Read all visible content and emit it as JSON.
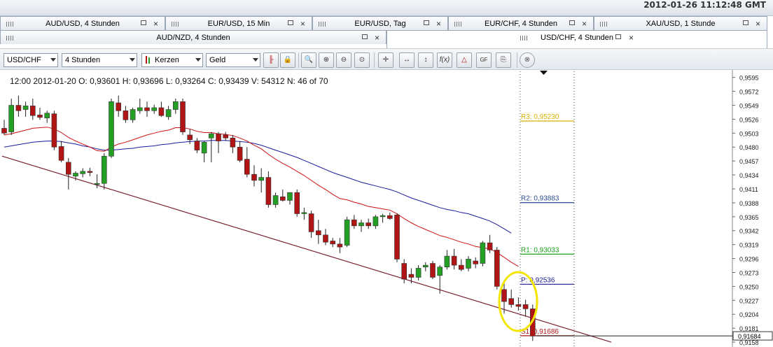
{
  "header": {
    "datetime": "2012-01-26 11:12:48 GMT"
  },
  "tabs_row1": [
    {
      "label": "AUD/USD,  4 Stunden"
    },
    {
      "label": "EUR/USD,  15 Min"
    },
    {
      "label": "EUR/USD,  Tag"
    },
    {
      "label": "EUR/CHF,  4 Stunden"
    },
    {
      "label": "XAU/USD,  1 Stunde"
    }
  ],
  "tabs_row2": [
    {
      "label": "AUD/NZD,  4 Stunden"
    },
    {
      "label": "USD/CHF,  4 Stunden",
      "active": true
    }
  ],
  "toolbar": {
    "instrument": "USD/CHF",
    "period": "4 Stunden",
    "chart_type": "Kerzen",
    "price_side": "Geld",
    "buttons": [
      "candle-settings-icon",
      "lock-icon",
      "zoom-icon",
      "zoom-in-icon",
      "zoom-out-icon",
      "zoom-fit-icon",
      "crosshair-icon",
      "horizontal-line-icon",
      "vertical-line-icon",
      "indicator-fx-icon",
      "pattern-icon",
      "fibonacci-icon",
      "copy-icon",
      "save-icon",
      "close-chart-icon"
    ]
  },
  "chart_data": {
    "type": "candlestick",
    "info": "12:00  2012-01-20   O: 0,93601   H: 0,93696   L: 0,93264   C: 0,93439   V: 54312   N: 46 of 70",
    "ylim": [
      0.915,
      0.9605
    ],
    "y_ticks": [
      "0,9595",
      "0,9572",
      "0,9549",
      "0,9526",
      "0,9503",
      "0,9480",
      "0,9457",
      "0,9434",
      "0,9411",
      "0,9388",
      "0,9365",
      "0,9342",
      "0,9319",
      "0,9296",
      "0,9273",
      "0,9250",
      "0,9227",
      "0,9204",
      "0,9181",
      "0,9158"
    ],
    "current_price": "0,91684",
    "colors": {
      "up": "#23a023",
      "down": "#b01414",
      "ma_fast": "#cc1111",
      "ma_slow": "#1a1a9c",
      "trend": "#7a2030",
      "highlight": "#f2e600"
    },
    "candles": [
      {
        "o": 0.9511,
        "h": 0.9525,
        "l": 0.95,
        "c": 0.9503
      },
      {
        "o": 0.9505,
        "h": 0.956,
        "l": 0.95,
        "c": 0.9549
      },
      {
        "o": 0.9549,
        "h": 0.9565,
        "l": 0.953,
        "c": 0.954
      },
      {
        "o": 0.9542,
        "h": 0.9555,
        "l": 0.953,
        "c": 0.9548
      },
      {
        "o": 0.9548,
        "h": 0.956,
        "l": 0.9525,
        "c": 0.9532
      },
      {
        "o": 0.9533,
        "h": 0.9545,
        "l": 0.9525,
        "c": 0.9529
      },
      {
        "o": 0.9528,
        "h": 0.954,
        "l": 0.952,
        "c": 0.9536
      },
      {
        "o": 0.9535,
        "h": 0.954,
        "l": 0.9475,
        "c": 0.948
      },
      {
        "o": 0.9481,
        "h": 0.949,
        "l": 0.9455,
        "c": 0.9458
      },
      {
        "o": 0.9455,
        "h": 0.9462,
        "l": 0.941,
        "c": 0.9435
      },
      {
        "o": 0.9432,
        "h": 0.944,
        "l": 0.9425,
        "c": 0.9437
      },
      {
        "o": 0.9436,
        "h": 0.9445,
        "l": 0.943,
        "c": 0.944
      },
      {
        "o": 0.944,
        "h": 0.9446,
        "l": 0.9432,
        "c": 0.9438
      },
      {
        "o": 0.942,
        "h": 0.9435,
        "l": 0.9412,
        "c": 0.942
      },
      {
        "o": 0.942,
        "h": 0.947,
        "l": 0.941,
        "c": 0.9465
      },
      {
        "o": 0.9465,
        "h": 0.956,
        "l": 0.9462,
        "c": 0.9555
      },
      {
        "o": 0.9553,
        "h": 0.9565,
        "l": 0.953,
        "c": 0.954
      },
      {
        "o": 0.954,
        "h": 0.9548,
        "l": 0.952,
        "c": 0.9525
      },
      {
        "o": 0.9525,
        "h": 0.9545,
        "l": 0.952,
        "c": 0.9542
      },
      {
        "o": 0.954,
        "h": 0.956,
        "l": 0.9535,
        "c": 0.9545
      },
      {
        "o": 0.9545,
        "h": 0.9555,
        "l": 0.953,
        "c": 0.954
      },
      {
        "o": 0.954,
        "h": 0.955,
        "l": 0.9535,
        "c": 0.9545
      },
      {
        "o": 0.9545,
        "h": 0.9555,
        "l": 0.953,
        "c": 0.9532
      },
      {
        "o": 0.953,
        "h": 0.9548,
        "l": 0.9525,
        "c": 0.9542
      },
      {
        "o": 0.9542,
        "h": 0.956,
        "l": 0.9535,
        "c": 0.9555
      },
      {
        "o": 0.9555,
        "h": 0.956,
        "l": 0.95,
        "c": 0.9505
      },
      {
        "o": 0.95,
        "h": 0.951,
        "l": 0.9485,
        "c": 0.9492
      },
      {
        "o": 0.949,
        "h": 0.9495,
        "l": 0.947,
        "c": 0.9475
      },
      {
        "o": 0.947,
        "h": 0.949,
        "l": 0.9455,
        "c": 0.9488
      },
      {
        "o": 0.9495,
        "h": 0.9505,
        "l": 0.9455,
        "c": 0.9502
      },
      {
        "o": 0.9502,
        "h": 0.9505,
        "l": 0.947,
        "c": 0.949
      },
      {
        "o": 0.95,
        "h": 0.9505,
        "l": 0.949,
        "c": 0.9495
      },
      {
        "o": 0.9495,
        "h": 0.95,
        "l": 0.947,
        "c": 0.948
      },
      {
        "o": 0.948,
        "h": 0.949,
        "l": 0.9455,
        "c": 0.9458
      },
      {
        "o": 0.946,
        "h": 0.948,
        "l": 0.943,
        "c": 0.9435
      },
      {
        "o": 0.9435,
        "h": 0.945,
        "l": 0.9415,
        "c": 0.9425
      },
      {
        "o": 0.9425,
        "h": 0.9445,
        "l": 0.9405,
        "c": 0.943
      },
      {
        "o": 0.943,
        "h": 0.944,
        "l": 0.938,
        "c": 0.9385
      },
      {
        "o": 0.9385,
        "h": 0.9405,
        "l": 0.938,
        "c": 0.94
      },
      {
        "o": 0.9398,
        "h": 0.941,
        "l": 0.939,
        "c": 0.9392
      },
      {
        "o": 0.9392,
        "h": 0.9405,
        "l": 0.9385,
        "c": 0.9405
      },
      {
        "o": 0.9405,
        "h": 0.941,
        "l": 0.9365,
        "c": 0.937
      },
      {
        "o": 0.937,
        "h": 0.938,
        "l": 0.936,
        "c": 0.9372
      },
      {
        "o": 0.937,
        "h": 0.9375,
        "l": 0.933,
        "c": 0.934
      },
      {
        "o": 0.9342,
        "h": 0.936,
        "l": 0.932,
        "c": 0.9335
      },
      {
        "o": 0.9335,
        "h": 0.9345,
        "l": 0.9318,
        "c": 0.9323
      },
      {
        "o": 0.9325,
        "h": 0.933,
        "l": 0.9315,
        "c": 0.932
      },
      {
        "o": 0.932,
        "h": 0.933,
        "l": 0.9305,
        "c": 0.9315
      },
      {
        "o": 0.9318,
        "h": 0.9365,
        "l": 0.9315,
        "c": 0.936
      },
      {
        "o": 0.936,
        "h": 0.9368,
        "l": 0.9345,
        "c": 0.935
      },
      {
        "o": 0.935,
        "h": 0.936,
        "l": 0.934,
        "c": 0.9355
      },
      {
        "o": 0.9355,
        "h": 0.9362,
        "l": 0.9345,
        "c": 0.935
      },
      {
        "o": 0.935,
        "h": 0.9368,
        "l": 0.9345,
        "c": 0.9365
      },
      {
        "o": 0.9365,
        "h": 0.937,
        "l": 0.9355,
        "c": 0.9367
      },
      {
        "o": 0.9367,
        "h": 0.9372,
        "l": 0.936,
        "c": 0.9362
      },
      {
        "o": 0.9368,
        "h": 0.937,
        "l": 0.929,
        "c": 0.9295
      },
      {
        "o": 0.9288,
        "h": 0.9295,
        "l": 0.9255,
        "c": 0.9262
      },
      {
        "o": 0.927,
        "h": 0.928,
        "l": 0.9255,
        "c": 0.9265
      },
      {
        "o": 0.9265,
        "h": 0.9285,
        "l": 0.926,
        "c": 0.928
      },
      {
        "o": 0.9282,
        "h": 0.929,
        "l": 0.9275,
        "c": 0.9285
      },
      {
        "o": 0.9288,
        "h": 0.9292,
        "l": 0.9262,
        "c": 0.9265
      },
      {
        "o": 0.9268,
        "h": 0.9285,
        "l": 0.9238,
        "c": 0.9282
      },
      {
        "o": 0.9282,
        "h": 0.931,
        "l": 0.9278,
        "c": 0.93
      },
      {
        "o": 0.93,
        "h": 0.9312,
        "l": 0.9278,
        "c": 0.9285
      },
      {
        "o": 0.9285,
        "h": 0.9295,
        "l": 0.9275,
        "c": 0.9278
      },
      {
        "o": 0.928,
        "h": 0.93,
        "l": 0.9275,
        "c": 0.9295
      },
      {
        "o": 0.9292,
        "h": 0.9298,
        "l": 0.928,
        "c": 0.9287
      },
      {
        "o": 0.9288,
        "h": 0.9325,
        "l": 0.9283,
        "c": 0.9322
      },
      {
        "o": 0.9322,
        "h": 0.9335,
        "l": 0.9305,
        "c": 0.931
      },
      {
        "o": 0.931,
        "h": 0.9315,
        "l": 0.9245,
        "c": 0.925
      },
      {
        "o": 0.9245,
        "h": 0.9255,
        "l": 0.9205,
        "c": 0.9225
      },
      {
        "o": 0.923,
        "h": 0.9245,
        "l": 0.9215,
        "c": 0.922
      },
      {
        "o": 0.922,
        "h": 0.9232,
        "l": 0.921,
        "c": 0.9217
      },
      {
        "o": 0.922,
        "h": 0.9228,
        "l": 0.92,
        "c": 0.9213
      },
      {
        "o": 0.9213,
        "h": 0.922,
        "l": 0.916,
        "c": 0.9168
      }
    ],
    "ma_fast": [
      0.95,
      0.9502,
      0.9505,
      0.9508,
      0.9511,
      0.9512,
      0.9513,
      0.951,
      0.9504,
      0.9496,
      0.949,
      0.9485,
      0.948,
      0.9474,
      0.9473,
      0.948,
      0.9485,
      0.9488,
      0.9492,
      0.9496,
      0.95,
      0.9503,
      0.9506,
      0.9508,
      0.9512,
      0.9512,
      0.951,
      0.9506,
      0.9504,
      0.9504,
      0.9502,
      0.9501,
      0.9499,
      0.9495,
      0.949,
      0.9483,
      0.9477,
      0.9468,
      0.946,
      0.9453,
      0.9447,
      0.944,
      0.9433,
      0.9425,
      0.9417,
      0.941,
      0.9402,
      0.9395,
      0.9393,
      0.9389,
      0.9386,
      0.9382,
      0.938,
      0.9378,
      0.9376,
      0.937,
      0.9362,
      0.9355,
      0.9349,
      0.9344,
      0.9339,
      0.9334,
      0.9331,
      0.9327,
      0.9323,
      0.932,
      0.9316,
      0.9314,
      0.9312,
      0.9306,
      0.9298,
      0.929,
      0.9283
    ],
    "ma_slow": [
      0.948,
      0.9482,
      0.9484,
      0.9486,
      0.9488,
      0.9489,
      0.949,
      0.949,
      0.9489,
      0.9487,
      0.9485,
      0.9482,
      0.948,
      0.9477,
      0.9475,
      0.9475,
      0.9476,
      0.9477,
      0.9478,
      0.948,
      0.9481,
      0.9482,
      0.9484,
      0.9485,
      0.9487,
      0.9488,
      0.9489,
      0.949,
      0.949,
      0.9491,
      0.9491,
      0.9491,
      0.949,
      0.9489,
      0.9488,
      0.9486,
      0.9483,
      0.9479,
      0.9475,
      0.9471,
      0.9467,
      0.9463,
      0.9458,
      0.9453,
      0.9448,
      0.9443,
      0.9438,
      0.9434,
      0.943,
      0.9426,
      0.9422,
      0.9419,
      0.9416,
      0.9413,
      0.941,
      0.9406,
      0.9401,
      0.9396,
      0.9392,
      0.9388,
      0.9384,
      0.938,
      0.9377,
      0.9375,
      0.9372,
      0.937,
      0.9366,
      0.9362,
      0.9358,
      0.9352,
      0.9345,
      0.9338
    ],
    "trend_line": {
      "from": {
        "i": -0.3,
        "y": 0.9465
      },
      "to": {
        "i": 85,
        "y": 0.9158
      }
    },
    "pivot_levels": [
      {
        "label": "R3: 0,95230",
        "value": 0.9523,
        "color": "#d8b200"
      },
      {
        "label": "R2: 0,93883",
        "value": 0.93883,
        "color": "#2a4d8f"
      },
      {
        "label": "R1: 0,93033",
        "value": 0.93033,
        "color": "#1a9e1a"
      },
      {
        "label": "P: 0,92536",
        "value": 0.92536,
        "color": "#1a1a8c"
      },
      {
        "label": "S1: 0,91686",
        "value": 0.91686,
        "color": "#b01414"
      }
    ]
  }
}
